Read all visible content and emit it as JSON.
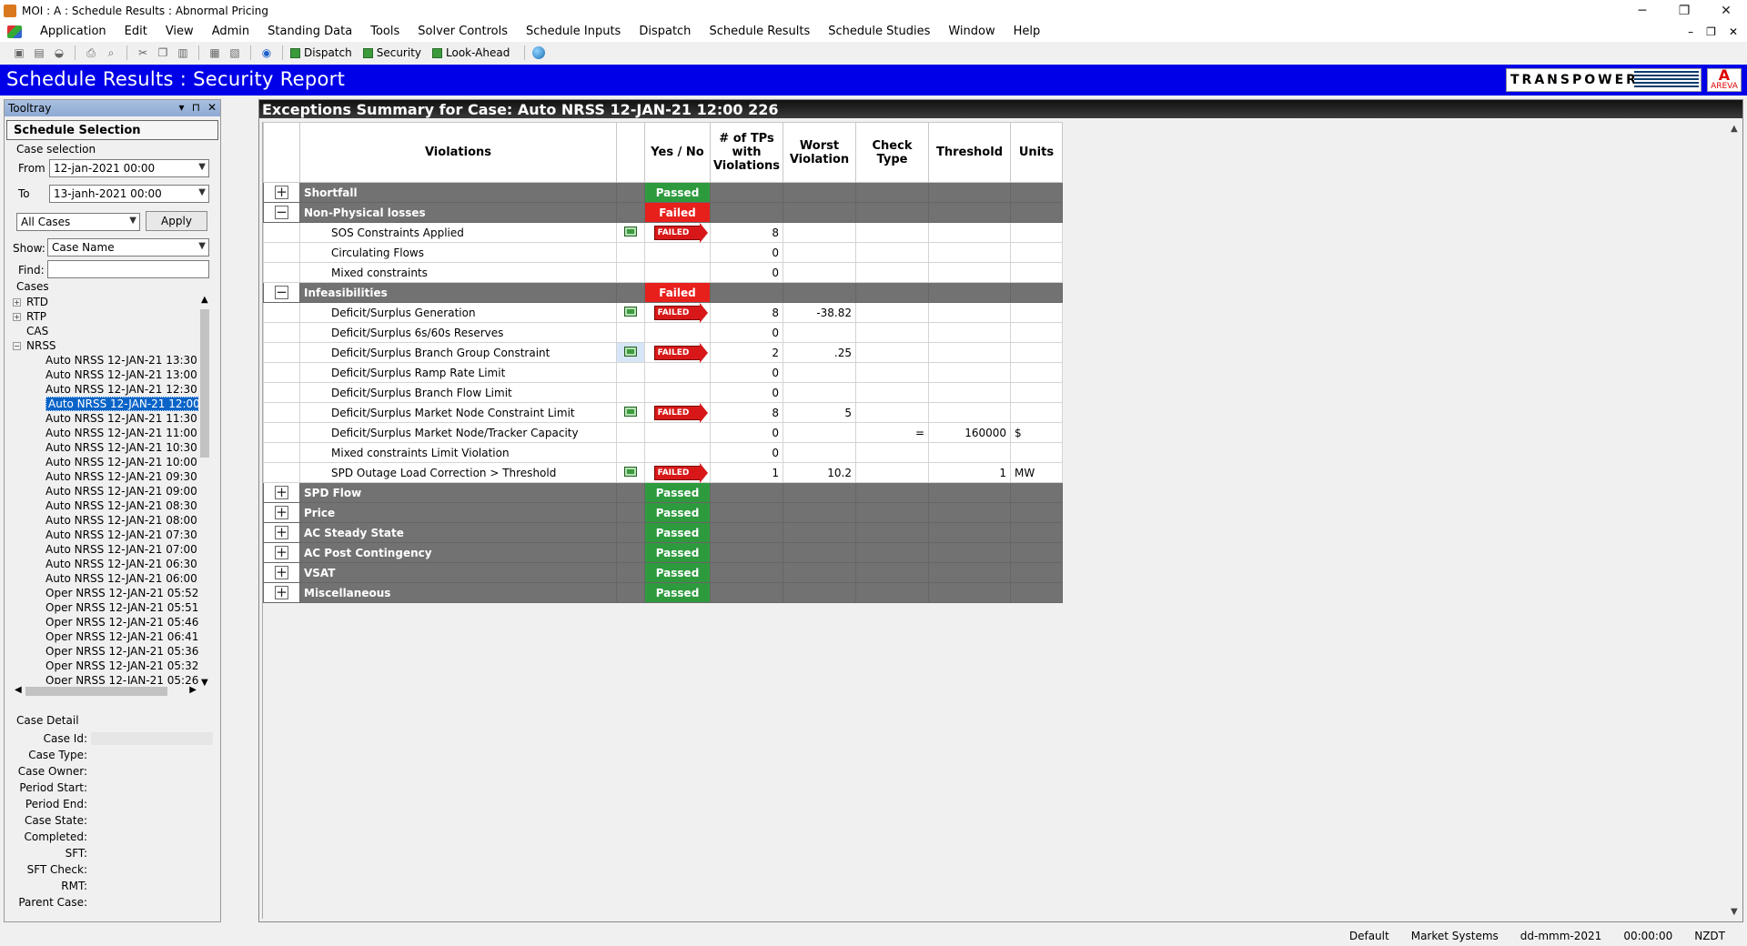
{
  "window": {
    "title": "MOI : A : Schedule Results : Abnormal Pricing",
    "minimize_glyph": "─",
    "restore_glyph": "❐",
    "close_glyph": "✕",
    "mdi_min_glyph": "–",
    "mdi_restore_glyph": "❐",
    "mdi_close_glyph": "✕"
  },
  "menu": [
    "Application",
    "Edit",
    "View",
    "Admin",
    "Standing Data",
    "Tools",
    "Solver Controls",
    "Schedule Inputs",
    "Dispatch",
    "Schedule Results",
    "Schedule Studies",
    "Window",
    "Help"
  ],
  "toolbar": {
    "dispatch_label": "Dispatch",
    "security_label": "Security",
    "lookahead_label": "Look-Ahead"
  },
  "banner": {
    "title": "Schedule Results : Security Report",
    "brand": "TRANSPOWER",
    "areva_mark": "A",
    "areva_text": "AREVA"
  },
  "tooltray": {
    "title": "Tooltray",
    "pin_glyph": "▾",
    "dock_glyph": "⊓",
    "close_glyph": "✕",
    "section_title": "Schedule Selection",
    "case_selection_label": "Case selection",
    "from_label": "From",
    "from_value": "12-jan-2021 00:00",
    "to_label": "To",
    "to_value": "13-janh-2021 00:00",
    "filter_value": "All Cases",
    "apply_label": "Apply",
    "show_label": "Show:",
    "show_value": "Case Name",
    "find_label": "Find:",
    "find_value": "",
    "cases_label": "Cases",
    "tree_roots": [
      "RTD",
      "RTP",
      "CAS",
      "NRSS"
    ],
    "cases": [
      "Auto NRSS 12-JAN-21 13:30",
      "Auto NRSS 12-JAN-21 13:00",
      "Auto NRSS 12-JAN-21 12:30",
      "Auto NRSS 12-JAN-21 12:00",
      "Auto NRSS 12-JAN-21 11:30",
      "Auto NRSS 12-JAN-21 11:00",
      "Auto NRSS 12-JAN-21 10:30",
      "Auto NRSS 12-JAN-21 10:00",
      "Auto NRSS 12-JAN-21 09:30",
      "Auto NRSS 12-JAN-21 09:00",
      "Auto NRSS 12-JAN-21 08:30",
      "Auto NRSS 12-JAN-21 08:00",
      "Auto NRSS 12-JAN-21 07:30",
      "Auto NRSS 12-JAN-21 07:00",
      "Auto NRSS 12-JAN-21 06:30",
      "Auto NRSS 12-JAN-21 06:00",
      "Oper NRSS 12-JAN-21 05:52",
      "Oper NRSS 12-JAN-21 05:51",
      "Oper NRSS 12-JAN-21 05:46",
      "Oper NRSS 12-JAN-21 06:41",
      "Oper NRSS 12-JAN-21 05:36",
      "Oper NRSS 12-JAN-21 05:32",
      "Oper NRSS 12-JAN-21 05:26"
    ],
    "selected_case": "Auto NRSS 12-JAN-21 12:00",
    "case_detail_label": "Case Detail",
    "detail_fields": [
      "Case Id:",
      "Case Type:",
      "Case Owner:",
      "Period Start:",
      "Period End:",
      "Case State:",
      "Completed:",
      "SFT:",
      "SFT Check:",
      "RMT:",
      "Parent Case:"
    ]
  },
  "summary": {
    "title": "Exceptions Summary for Case: Auto NRSS 12-JAN-21 12:00 226",
    "columns": {
      "violations": "Violations",
      "yesno": "Yes / No",
      "tps_l1": "# of TPs",
      "tps_l2": "with",
      "tps_l3": "Violations",
      "worst_l1": "Worst",
      "worst_l2": "Violation",
      "check_l1": "Check",
      "check_l2": "Type",
      "threshold": "Threshold",
      "units": "Units"
    },
    "failed_tag": "FAILED",
    "rows": [
      {
        "kind": "cat",
        "expand": "+",
        "name": "Shortfall",
        "status": "Passed"
      },
      {
        "kind": "cat",
        "expand": "−",
        "name": "Non-Physical losses",
        "status": "Failed"
      },
      {
        "kind": "sub",
        "name": "SOS Constraints Applied",
        "icon": true,
        "failed": true,
        "tps": "8",
        "worst": "",
        "check": "",
        "threshold": "",
        "units": ""
      },
      {
        "kind": "sub",
        "name": "Circulating Flows",
        "icon": false,
        "failed": false,
        "tps": "0",
        "worst": "",
        "check": "",
        "threshold": "",
        "units": ""
      },
      {
        "kind": "sub",
        "name": "Mixed constraints",
        "icon": false,
        "failed": false,
        "tps": "0",
        "worst": "",
        "check": "",
        "threshold": "",
        "units": ""
      },
      {
        "kind": "cat",
        "expand": "−",
        "name": "Infeasibilities",
        "status": "Failed"
      },
      {
        "kind": "sub",
        "name": "Deficit/Surplus Generation",
        "icon": true,
        "failed": true,
        "tps": "8",
        "worst": "-38.82",
        "check": "",
        "threshold": "",
        "units": ""
      },
      {
        "kind": "sub",
        "name": "Deficit/Surplus 6s/60s Reserves",
        "icon": false,
        "failed": false,
        "tps": "0",
        "worst": "",
        "check": "",
        "threshold": "",
        "units": ""
      },
      {
        "kind": "sub",
        "name": "Deficit/Surplus Branch Group Constraint",
        "icon": true,
        "iconbg": true,
        "failed": true,
        "tps": "2",
        "worst": ".25",
        "check": "",
        "threshold": "",
        "units": ""
      },
      {
        "kind": "sub",
        "name": "Deficit/Surplus Ramp Rate Limit",
        "icon": false,
        "failed": false,
        "tps": "0",
        "worst": "",
        "check": "",
        "threshold": "",
        "units": ""
      },
      {
        "kind": "sub",
        "name": "Deficit/Surplus Branch Flow Limit",
        "icon": false,
        "failed": false,
        "tps": "0",
        "worst": "",
        "check": "",
        "threshold": "",
        "units": ""
      },
      {
        "kind": "sub",
        "name": "Deficit/Surplus Market Node Constraint Limit",
        "icon": true,
        "failed": true,
        "tps": "8",
        "worst": "5",
        "check": "",
        "threshold": "",
        "units": ""
      },
      {
        "kind": "sub",
        "name": "Deficit/Surplus Market Node/Tracker Capacity",
        "icon": false,
        "failed": false,
        "tps": "0",
        "worst": "",
        "check": "=",
        "threshold": "160000",
        "units": "$"
      },
      {
        "kind": "sub",
        "name": "Mixed constraints Limit Violation",
        "icon": false,
        "failed": false,
        "tps": "0",
        "worst": "",
        "check": "",
        "threshold": "",
        "units": ""
      },
      {
        "kind": "sub",
        "name": "SPD Outage Load Correction > Threshold",
        "icon": true,
        "failed": true,
        "tps": "1",
        "worst": "10.2",
        "check": "",
        "threshold": "1",
        "units": "MW"
      },
      {
        "kind": "cat",
        "expand": "+",
        "name": "SPD Flow",
        "status": "Passed"
      },
      {
        "kind": "cat",
        "expand": "+",
        "name": "Price",
        "status": "Passed"
      },
      {
        "kind": "cat",
        "expand": "+",
        "name": "AC Steady State",
        "status": "Passed"
      },
      {
        "kind": "cat",
        "expand": "+",
        "name": "AC Post Contingency",
        "status": "Passed"
      },
      {
        "kind": "cat",
        "expand": "+",
        "name": "VSAT",
        "status": "Passed"
      },
      {
        "kind": "cat",
        "expand": "+",
        "name": "Miscellaneous",
        "status": "Passed"
      }
    ]
  },
  "status": [
    "Default",
    "Market Systems",
    "dd-mmm-2021",
    "00:00:00",
    "NZDT"
  ],
  "colors": {
    "banner": "#0000e8",
    "passed": "#2e9a3e",
    "failed": "#e8201c",
    "category_row": "#727272",
    "selection": "#0a64c8"
  }
}
